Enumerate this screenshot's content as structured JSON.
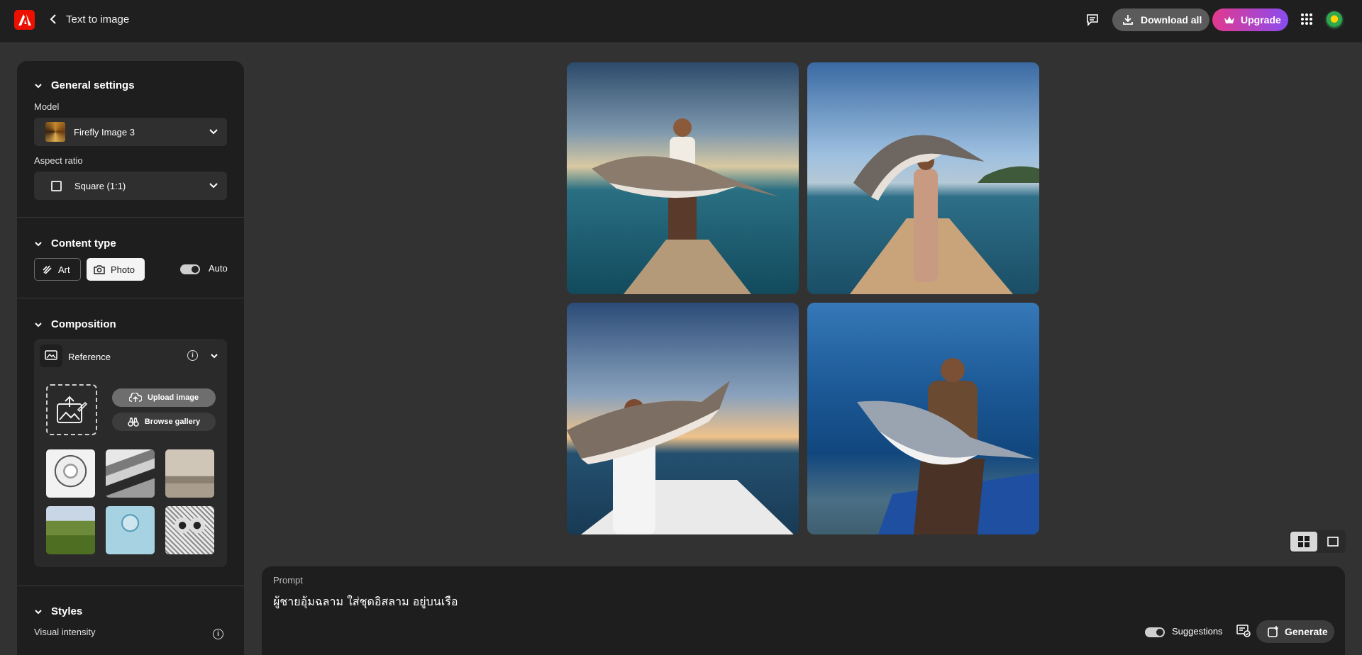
{
  "header": {
    "title": "Text to image",
    "download_label": "Download all",
    "upgrade_label": "Upgrade"
  },
  "sidebar": {
    "general": {
      "heading": "General settings",
      "model_label": "Model",
      "model_value": "Firefly Image 3",
      "aspect_label": "Aspect ratio",
      "aspect_value": "Square (1:1)"
    },
    "content_type": {
      "heading": "Content type",
      "art_label": "Art",
      "photo_label": "Photo",
      "selected": "Photo",
      "auto_label": "Auto"
    },
    "composition": {
      "heading": "Composition",
      "reference_label": "Reference",
      "upload_label": "Upload image",
      "browse_label": "Browse gallery"
    },
    "styles": {
      "heading": "Styles",
      "visual_intensity_label": "Visual intensity"
    }
  },
  "prompt": {
    "label": "Prompt",
    "text": "ผู้ชายอุ้มฉลาม ใส่ชุดอิสลาม อยู่บนเรือ",
    "suggestions_label": "Suggestions",
    "generate_label": "Generate"
  },
  "colors": {
    "brand": "#eb1000",
    "upgrade_gradient_start": "#e2398e",
    "upgrade_gradient_end": "#8a4cf0",
    "panel_bg": "#1e1e1e",
    "canvas_bg": "#323232"
  }
}
